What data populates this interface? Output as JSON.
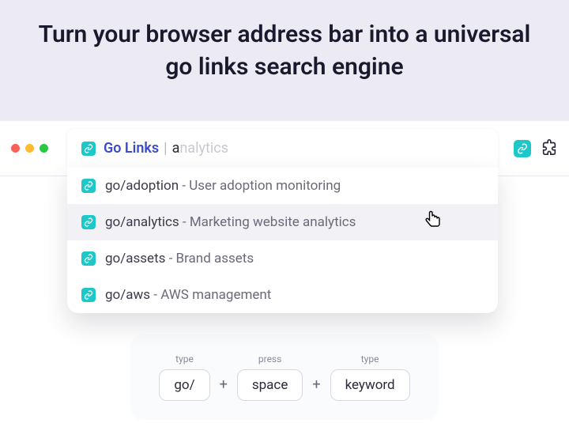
{
  "hero": {
    "headline": "Turn your browser address bar into a universal go links search engine"
  },
  "omnibox": {
    "brand": "Go Links",
    "typed": "a",
    "autocomplete": "nalytics"
  },
  "suggestions": [
    {
      "slug": "go/adoption",
      "desc": "User adoption monitoring",
      "active": false
    },
    {
      "slug": "go/analytics",
      "desc": "Marketing website analytics",
      "active": true
    },
    {
      "slug": "go/assets",
      "desc": "Brand assets",
      "active": false
    },
    {
      "slug": "go/aws",
      "desc": "AWS management",
      "active": false
    }
  ],
  "instructions": {
    "step1_label": "type",
    "step1_value": "go/",
    "step2_label": "press",
    "step2_value": "space",
    "step3_label": "type",
    "step3_value": "keyword"
  }
}
